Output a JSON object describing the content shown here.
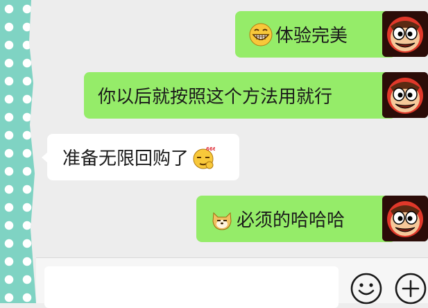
{
  "messages": [
    {
      "side": "out",
      "text": "体验完美",
      "emoji": "grinning-face-icon"
    },
    {
      "side": "out",
      "text": "你以后就按照这个方法用就行"
    },
    {
      "side": "in",
      "text": "准备无限回购了",
      "emoji": "smirk-666-icon"
    },
    {
      "side": "out",
      "text": "必须的哈哈哈",
      "emoji": "doge-icon"
    }
  ],
  "composer": {
    "value": ""
  },
  "colors": {
    "outgoing_bubble": "#95ec69",
    "incoming_bubble": "#ffffff",
    "background": "#ededed"
  },
  "icons": [
    "emoji-picker-icon",
    "plus-icon"
  ]
}
